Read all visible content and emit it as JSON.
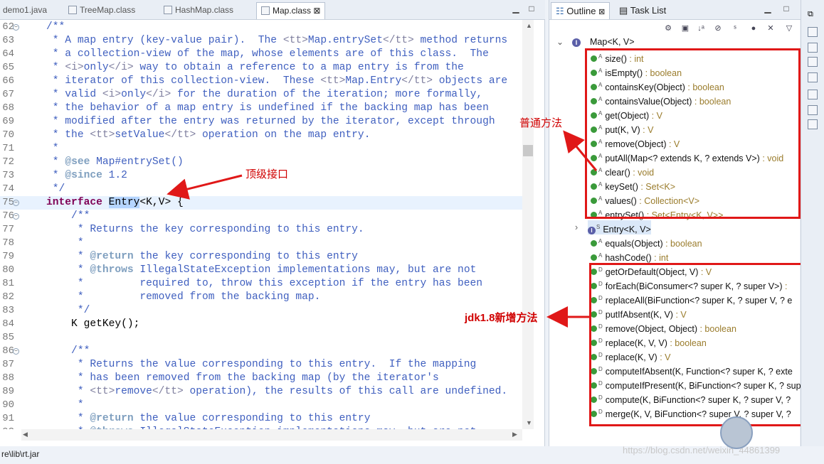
{
  "editor_tabs": [
    {
      "label": "demo1.java"
    },
    {
      "label": "TreeMap.class"
    },
    {
      "label": "HashMap.class"
    },
    {
      "label": "Map.class",
      "close": "⊠"
    }
  ],
  "code_lines": [
    {
      "num": "62",
      "fold": "−",
      "html": "<span class=\"cm\">    /**</span>"
    },
    {
      "num": "63",
      "html": "<span class=\"cm\">     * A map entry (key-value pair).  The </span><span class=\"tag\">&lt;tt&gt;</span><span class=\"cm\">Map.entrySet</span><span class=\"tag\">&lt;/tt&gt;</span><span class=\"cm\"> method returns</span>"
    },
    {
      "num": "64",
      "html": "<span class=\"cm\">     * a collection-view of the map, whose elements are of this class.  The</span>"
    },
    {
      "num": "65",
      "html": "<span class=\"cm\">     * </span><span class=\"tag\">&lt;i&gt;</span><span class=\"cm\">only</span><span class=\"tag\">&lt;/i&gt;</span><span class=\"cm\"> way to obtain a reference to a map entry is from the</span>"
    },
    {
      "num": "66",
      "html": "<span class=\"cm\">     * iterator of this collection-view.  These </span><span class=\"tag\">&lt;tt&gt;</span><span class=\"cm\">Map.Entry</span><span class=\"tag\">&lt;/tt&gt;</span><span class=\"cm\"> objects are</span>"
    },
    {
      "num": "67",
      "html": "<span class=\"cm\">     * valid </span><span class=\"tag\">&lt;i&gt;</span><span class=\"cm\">only</span><span class=\"tag\">&lt;/i&gt;</span><span class=\"cm\"> for the duration of the iteration; more formally,</span>"
    },
    {
      "num": "68",
      "html": "<span class=\"cm\">     * the behavior of a map entry is undefined if the backing map has been</span>"
    },
    {
      "num": "69",
      "html": "<span class=\"cm\">     * modified after the entry was returned by the iterator, except through</span>"
    },
    {
      "num": "70",
      "html": "<span class=\"cm\">     * the </span><span class=\"tag\">&lt;tt&gt;</span><span class=\"cm\">setValue</span><span class=\"tag\">&lt;/tt&gt;</span><span class=\"cm\"> operation on the map entry.</span>"
    },
    {
      "num": "71",
      "html": "<span class=\"cm\">     *</span>"
    },
    {
      "num": "72",
      "html": "<span class=\"cm\">     * </span><span class=\"tg\">@see</span><span class=\"cm\"> Map#entrySet()</span>"
    },
    {
      "num": "73",
      "html": "<span class=\"cm\">     * </span><span class=\"tg\">@since</span><span class=\"cm\"> 1.2</span>"
    },
    {
      "num": "74",
      "html": "<span class=\"cm\">     */</span>"
    },
    {
      "num": "75",
      "fold": "−",
      "cur": true,
      "html": "    <span class=\"kw\">interface</span> <span class=\"hl\">Entry</span>&lt;K,V&gt; {"
    },
    {
      "num": "76",
      "fold": "−",
      "html": "<span class=\"cm\">        /**</span>"
    },
    {
      "num": "77",
      "html": "<span class=\"cm\">         * Returns the key corresponding to this entry.</span>"
    },
    {
      "num": "78",
      "html": "<span class=\"cm\">         *</span>"
    },
    {
      "num": "79",
      "html": "<span class=\"cm\">         * </span><span class=\"tg\">@return</span><span class=\"cm\"> the key corresponding to this entry</span>"
    },
    {
      "num": "80",
      "html": "<span class=\"cm\">         * </span><span class=\"tg\">@throws</span><span class=\"cm\"> IllegalStateException implementations may, but are not</span>"
    },
    {
      "num": "81",
      "html": "<span class=\"cm\">         *         required to, throw this exception if the entry has been</span>"
    },
    {
      "num": "82",
      "html": "<span class=\"cm\">         *         removed from the backing map.</span>"
    },
    {
      "num": "83",
      "html": "<span class=\"cm\">         */</span>"
    },
    {
      "num": "84",
      "html": "        K getKey();"
    },
    {
      "num": "85",
      "html": ""
    },
    {
      "num": "86",
      "fold": "−",
      "html": "<span class=\"cm\">        /**</span>"
    },
    {
      "num": "87",
      "html": "<span class=\"cm\">         * Returns the value corresponding to this entry.  If the mapping</span>"
    },
    {
      "num": "88",
      "html": "<span class=\"cm\">         * has been removed from the backing map (by the iterator's</span>"
    },
    {
      "num": "89",
      "html": "<span class=\"cm\">         * </span><span class=\"tag\">&lt;tt&gt;</span><span class=\"cm\">remove</span><span class=\"tag\">&lt;/tt&gt;</span><span class=\"cm\"> operation), the results of this call are undefined.</span>"
    },
    {
      "num": "90",
      "html": "<span class=\"cm\">         *</span>"
    },
    {
      "num": "91",
      "html": "<span class=\"cm\">         * </span><span class=\"tg\">@return</span><span class=\"cm\"> the value corresponding to this entry</span>"
    },
    {
      "num": "92",
      "html": "<span class=\"cm\">         * </span><span class=\"tg\">@throws</span><span class=\"cm\"> IllegalStateException implementations may, but are not</span>"
    }
  ],
  "outline": {
    "tab_outline": "Outline",
    "tab_outline_close": "⊠",
    "tab_tasklist": "Task List",
    "root": "Map<K, V>",
    "members": [
      {
        "name": "size()",
        "type": " : int",
        "mod": "A"
      },
      {
        "name": "isEmpty()",
        "type": " : boolean",
        "mod": "A"
      },
      {
        "name": "containsKey(Object)",
        "type": " : boolean",
        "mod": "A"
      },
      {
        "name": "containsValue(Object)",
        "type": " : boolean",
        "mod": "A"
      },
      {
        "name": "get(Object)",
        "type": " : V",
        "mod": "A"
      },
      {
        "name": "put(K, V)",
        "type": " : V",
        "mod": "A"
      },
      {
        "name": "remove(Object)",
        "type": " : V",
        "mod": "A"
      },
      {
        "name": "putAll(Map<? extends K, ? extends V>)",
        "type": " : void",
        "mod": "A"
      },
      {
        "name": "clear()",
        "type": " : void",
        "mod": "A"
      },
      {
        "name": "keySet()",
        "type": " : Set<K>",
        "mod": "A"
      },
      {
        "name": "values()",
        "type": " : Collection<V>",
        "mod": "A"
      },
      {
        "name": "entrySet()",
        "type": " : Set<Entry<K, V>>",
        "mod": "A"
      },
      {
        "name": "Entry<K, V>",
        "type": "",
        "mod": "S",
        "interface": true
      },
      {
        "name": "equals(Object)",
        "type": " : boolean",
        "mod": "A"
      },
      {
        "name": "hashCode()",
        "type": " : int",
        "mod": "A"
      },
      {
        "name": "getOrDefault(Object, V)",
        "type": " : V",
        "mod": "D"
      },
      {
        "name": "forEach(BiConsumer<? super K, ? super V>)",
        "type": " :",
        "mod": "D"
      },
      {
        "name": "replaceAll(BiFunction<? super K, ? super V, ? e",
        "type": "",
        "mod": "D"
      },
      {
        "name": "putIfAbsent(K, V)",
        "type": " : V",
        "mod": "D"
      },
      {
        "name": "remove(Object, Object)",
        "type": " : boolean",
        "mod": "D"
      },
      {
        "name": "replace(K, V, V)",
        "type": " : boolean",
        "mod": "D"
      },
      {
        "name": "replace(K, V)",
        "type": " : V",
        "mod": "D"
      },
      {
        "name": "computeIfAbsent(K, Function<? super K, ? exte",
        "type": "",
        "mod": "D"
      },
      {
        "name": "computeIfPresent(K, BiFunction<? super K, ? super V",
        "type": "",
        "mod": "D"
      },
      {
        "name": "compute(K, BiFunction<? super K, ? super V, ?",
        "type": "",
        "mod": "D"
      },
      {
        "name": "merge(K, V, BiFunction<? super V, ? super V, ?",
        "type": "",
        "mod": "D"
      }
    ]
  },
  "annotations": {
    "top_interface": "顶级接口",
    "ordinary_methods": "普通方法",
    "jdk18_methods": "jdk1.8新增方法"
  },
  "status_text": "re\\lib\\rt.jar",
  "watermark": "https://blog.csdn.net/weixin_44861399",
  "colors": {
    "annotation_red": "#e01818",
    "comment_blue": "#3f5fbf",
    "keyword": "#7f0055"
  }
}
